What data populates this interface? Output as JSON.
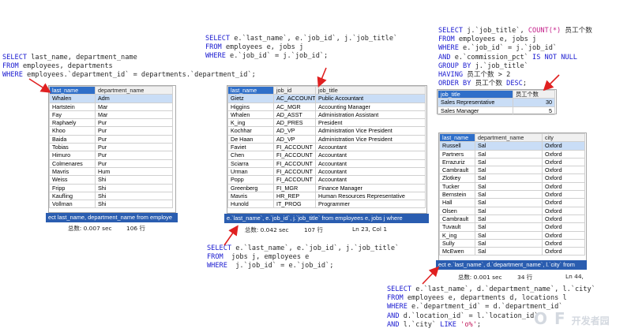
{
  "query1": {
    "lines": [
      [
        {
          "t": "SELECT",
          "k": "kw"
        },
        {
          "t": " last_name, department_name"
        }
      ],
      [
        {
          "t": "FROM",
          "k": "kw"
        },
        {
          "t": " employees, departments"
        }
      ],
      [
        {
          "t": "WHERE",
          "k": "kw"
        },
        {
          "t": " employees.`department_id` = departments.`department_id`;"
        }
      ]
    ],
    "columns": [
      "last_name",
      "department_name"
    ],
    "rows": [
      [
        "Whalen",
        "Adm"
      ],
      [
        "Hartstein",
        "Mar"
      ],
      [
        "Fay",
        "Mar"
      ],
      [
        "Raphaely",
        "Pur"
      ],
      [
        "Khoo",
        "Pur"
      ],
      [
        "Baida",
        "Pur"
      ],
      [
        "Tobias",
        "Pur"
      ],
      [
        "Himuro",
        "Pur"
      ],
      [
        "Colmenares",
        "Pur"
      ],
      [
        "Mavris",
        "Hum"
      ],
      [
        "Weiss",
        "Shi"
      ],
      [
        "Fripp",
        "Shi"
      ],
      [
        "Kaufling",
        "Shi"
      ],
      [
        "Vollman",
        "Shi"
      ]
    ],
    "status_sql": "ect last_name, department_name from employe",
    "total_label": "总数: 0.007 sec",
    "row_count": "106 行"
  },
  "query2": {
    "lines": [
      [
        {
          "t": "SELECT",
          "k": "kw"
        },
        {
          "t": " e.`last_name`, e.`job_id`, j.`job_title`"
        }
      ],
      [
        {
          "t": "FROM",
          "k": "kw"
        },
        {
          "t": " employees e, jobs j"
        }
      ],
      [
        {
          "t": "WHERE",
          "k": "kw"
        },
        {
          "t": " e.`job_id` = j.`job_id`;"
        }
      ]
    ],
    "columns": [
      "last_name",
      "job_id",
      "job_title"
    ],
    "rows": [
      [
        "Gietz",
        "AC_ACCOUNT",
        "Public Accountant"
      ],
      [
        "Higgins",
        "AC_MGR",
        "Accounting Manager"
      ],
      [
        "Whalen",
        "AD_ASST",
        "Administration Assistant"
      ],
      [
        "K_ing",
        "AD_PRES",
        "President"
      ],
      [
        "Kochhar",
        "AD_VP",
        "Administration Vice President"
      ],
      [
        "De Haan",
        "AD_VP",
        "Administration Vice President"
      ],
      [
        "Faviet",
        "FI_ACCOUNT",
        "Accountant"
      ],
      [
        "Chen",
        "FI_ACCOUNT",
        "Accountant"
      ],
      [
        "Sciarra",
        "FI_ACCOUNT",
        "Accountant"
      ],
      [
        "Urman",
        "FI_ACCOUNT",
        "Accountant"
      ],
      [
        "Popp",
        "FI_ACCOUNT",
        "Accountant"
      ],
      [
        "Greenberg",
        "FI_MGR",
        "Finance Manager"
      ],
      [
        "Mavris",
        "HR_REP",
        "Human Resources Representative"
      ],
      [
        "Hunold",
        "IT_PROG",
        "Programmer"
      ]
    ],
    "status_sql": "e.`last_name`, e.`job_id`, j.`job_title` from employees e, jobs j where",
    "total_label": "总数: 0.042 sec",
    "row_count": "107 行",
    "cursor_pos": "Ln 23, Col 1"
  },
  "query3": {
    "lines": [
      [
        {
          "t": "SELECT",
          "k": "kw"
        },
        {
          "t": " e.`last_name`, e.`job_id`, j.`job_title`"
        }
      ],
      [
        {
          "t": "FROM",
          "k": "kw"
        },
        {
          "t": "  jobs j, employees e"
        }
      ],
      [
        {
          "t": "WHERE",
          "k": "kw"
        },
        {
          "t": "  j.`job_id` = e.`job_id`;"
        }
      ]
    ]
  },
  "query4": {
    "lines": [
      [
        {
          "t": "SELECT",
          "k": "kw"
        },
        {
          "t": " j.`job_title`, "
        },
        {
          "t": "COUNT(*)",
          "k": "fn"
        },
        {
          "t": " 员工个数"
        }
      ],
      [
        {
          "t": "FROM",
          "k": "kw"
        },
        {
          "t": " employees e, jobs j"
        }
      ],
      [
        {
          "t": "WHERE",
          "k": "kw"
        },
        {
          "t": " e.`job_id` = j.`job_id`"
        }
      ],
      [
        {
          "t": "AND",
          "k": "kw"
        },
        {
          "t": " e.`commission_pct` "
        },
        {
          "t": "IS NOT NULL",
          "k": "kw"
        }
      ],
      [
        {
          "t": "GROUP BY",
          "k": "kw"
        },
        {
          "t": " j.`job_title`"
        }
      ],
      [
        {
          "t": "HAVING",
          "k": "kw"
        },
        {
          "t": " 员工个数 > 2"
        }
      ],
      [
        {
          "t": "ORDER BY",
          "k": "kw"
        },
        {
          "t": " 员工个数 "
        },
        {
          "t": "DESC",
          "k": "kw"
        },
        {
          "t": ";"
        }
      ]
    ],
    "columns": [
      "job_title",
      "员工个数"
    ],
    "rows": [
      [
        "Sales Representative",
        "30"
      ],
      [
        "Sales Manager",
        "5"
      ]
    ]
  },
  "query5": {
    "lines": [
      [
        {
          "t": "SELECT",
          "k": "kw"
        },
        {
          "t": " e.`last_name`, d.`department_name`, l.`city`"
        }
      ],
      [
        {
          "t": "FROM",
          "k": "kw"
        },
        {
          "t": " employees e, departments d, locations l"
        }
      ],
      [
        {
          "t": "WHERE",
          "k": "kw"
        },
        {
          "t": " e.`department_id` = d.`department_id`"
        }
      ],
      [
        {
          "t": "AND",
          "k": "kw"
        },
        {
          "t": " d.`location_id` = l.`location_id`"
        }
      ],
      [
        {
          "t": "AND",
          "k": "kw"
        },
        {
          "t": " l.`city` "
        },
        {
          "t": "LIKE",
          "k": "kw"
        },
        {
          "t": " "
        },
        {
          "t": "'o%'",
          "k": "str"
        },
        {
          "t": ";"
        }
      ]
    ],
    "columns": [
      "last_name",
      "department_name",
      "city"
    ],
    "rows": [
      [
        "Russell",
        "Sal",
        "Oxford"
      ],
      [
        "Partners",
        "Sal",
        "Oxford"
      ],
      [
        "Errazuriz",
        "Sal",
        "Oxford"
      ],
      [
        "Cambrault",
        "Sal",
        "Oxford"
      ],
      [
        "Zlotkey",
        "Sal",
        "Oxford"
      ],
      [
        "Tucker",
        "Sal",
        "Oxford"
      ],
      [
        "Bernstein",
        "Sal",
        "Oxford"
      ],
      [
        "Hall",
        "Sal",
        "Oxford"
      ],
      [
        "Olsen",
        "Sal",
        "Oxford"
      ],
      [
        "Cambrault",
        "Sal",
        "Oxford"
      ],
      [
        "Tuvault",
        "Sal",
        "Oxford"
      ],
      [
        "K_ing",
        "Sal",
        "Oxford"
      ],
      [
        "Sully",
        "Sal",
        "Oxford"
      ],
      [
        "McEwen",
        "Sal",
        "Oxford"
      ]
    ],
    "status_sql": "ect e.`last_name`, d.`department_name`, l.`city` from",
    "total_label": "总数: 0.001 sec",
    "row_count": "34 行",
    "cursor_pos": "Ln 44,"
  },
  "watermark": "开发者园",
  "arrow_color": "#e02020"
}
